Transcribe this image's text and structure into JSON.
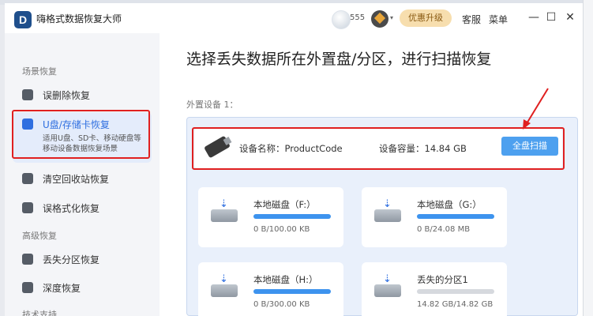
{
  "app": {
    "title": "嗨格式数据恢复大师",
    "logo_letter": "D"
  },
  "titlebar": {
    "user_count": "555",
    "upgrade": "优惠升级",
    "service": "客服",
    "menu": "菜单",
    "minimize": "—",
    "maximize": "☐",
    "close": "✕"
  },
  "sidebar": {
    "section_scene": "场景恢复",
    "section_advanced": "高级恢复",
    "section_support": "技术支持",
    "items": [
      {
        "label": "误删除恢复",
        "icon": "trash-restore-icon"
      },
      {
        "label": "U盘/存储卡恢复",
        "desc": "适用U盘、SD卡、移动硬盘等移动设备数据恢复场景",
        "icon": "usb-icon",
        "active": true
      },
      {
        "label": "清空回收站恢复",
        "icon": "recycle-bin-icon"
      },
      {
        "label": "误格式化恢复",
        "icon": "format-icon"
      },
      {
        "label": "丢失分区恢复",
        "icon": "partition-icon"
      },
      {
        "label": "深度恢复",
        "icon": "deep-scan-icon"
      }
    ]
  },
  "main": {
    "title": "选择丢失数据所在外置盘/分区，进行扫描恢复",
    "external_label": "外置设备 1：",
    "device": {
      "name": "设备名称：ProductCode",
      "capacity": "设备容量：14.84 GB",
      "scan_button": "全盘扫描"
    },
    "drives": [
      {
        "name": "本地磁盘（F:）",
        "size": "0 B/100.00 KB",
        "used_fraction": 1.0,
        "bar": "blue"
      },
      {
        "name": "本地磁盘（G:）",
        "size": "0 B/24.08 MB",
        "used_fraction": 1.0,
        "bar": "blue"
      },
      {
        "name": "本地磁盘（H:）",
        "size": "0 B/300.00 KB",
        "used_fraction": 1.0,
        "bar": "blue"
      },
      {
        "name": "丢失的分区1",
        "size": "14.82 GB/14.82 GB",
        "used_fraction": 1.0,
        "bar": "gray"
      }
    ]
  },
  "colors": {
    "accent": "#2f6fe0",
    "scan_button": "#4da0ef",
    "annotation_red": "#e02020",
    "upgrade_bg": "#f7deae"
  }
}
